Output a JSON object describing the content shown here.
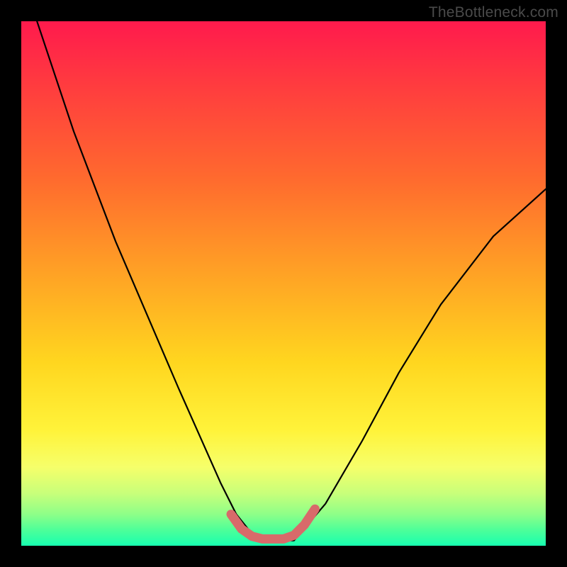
{
  "watermark": "TheBottleneck.com",
  "chart_data": {
    "type": "line",
    "title": "",
    "xlabel": "",
    "ylabel": "",
    "xlim": [
      0,
      100
    ],
    "ylim": [
      0,
      100
    ],
    "series": [
      {
        "name": "black-curve",
        "color": "#000000",
        "x": [
          3,
          10,
          18,
          24,
          30,
          34,
          38,
          41,
          45,
          52,
          58,
          65,
          72,
          80,
          90,
          100
        ],
        "values": [
          100,
          79,
          58,
          44,
          30,
          21,
          12,
          6,
          1,
          1,
          8,
          20,
          33,
          46,
          59,
          68
        ]
      },
      {
        "name": "pink-floor-segment",
        "color": "#d86a6a",
        "x": [
          40,
          42,
          44,
          46,
          48,
          50,
          52,
          54,
          56
        ],
        "values": [
          6,
          3.2,
          1.8,
          1.3,
          1.3,
          1.3,
          2,
          4,
          7
        ]
      }
    ],
    "gradient_stops": [
      {
        "pos": 0,
        "color": "#ff1a4d"
      },
      {
        "pos": 12,
        "color": "#ff3b3f"
      },
      {
        "pos": 30,
        "color": "#ff6a2e"
      },
      {
        "pos": 50,
        "color": "#ffa824"
      },
      {
        "pos": 65,
        "color": "#ffd61f"
      },
      {
        "pos": 78,
        "color": "#fff33a"
      },
      {
        "pos": 85,
        "color": "#f6ff6a"
      },
      {
        "pos": 90,
        "color": "#c8ff7a"
      },
      {
        "pos": 94,
        "color": "#8eff88"
      },
      {
        "pos": 97,
        "color": "#4dff99"
      },
      {
        "pos": 100,
        "color": "#18ffb0"
      }
    ]
  }
}
